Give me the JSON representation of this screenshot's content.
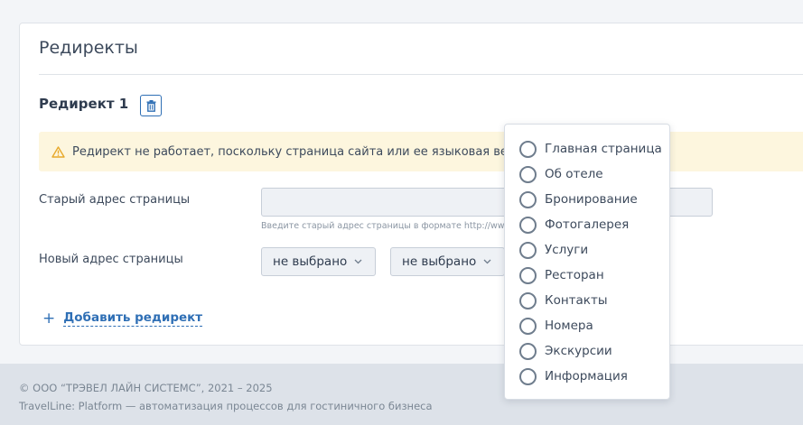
{
  "card": {
    "title": "Редиректы"
  },
  "redirect": {
    "heading": "Редирект 1",
    "warning_text": "Редирект не работает, поскольку страница сайта или ее языковая вер",
    "old_address_label": "Старый адрес страницы",
    "old_address_value": "",
    "old_address_hint": "Введите старый адрес страницы в формате http://www.",
    "new_address_label": "Новый адрес страницы",
    "select_1_value": "не выбрано",
    "select_2_value": "не выбрано"
  },
  "add_redirect_label": "Добавить редирект",
  "dropdown": {
    "options": [
      "Главная страница",
      "Об отеле",
      "Бронирование",
      "Фотогалерея",
      "Услуги",
      "Ресторан",
      "Контакты",
      "Номера",
      "Экскурсии",
      "Информация"
    ]
  },
  "footer": {
    "copyright": "© ООО “ТРЭВЕЛ ЛАЙН СИСТЕМС”, 2021 – 2025",
    "tagline": "TravelLine: Platform — автоматизация процессов для гостиничного бизнеса"
  },
  "colors": {
    "accent": "#2f6fb5",
    "warning_bg": "#fdf6de",
    "warning_icon": "#e8a92b",
    "footer_bg": "#dde2e9"
  },
  "icons": {
    "delete": "trash-icon",
    "warning": "warning-icon",
    "select_arrow": "chevron-down-icon",
    "add": "plus-icon"
  }
}
